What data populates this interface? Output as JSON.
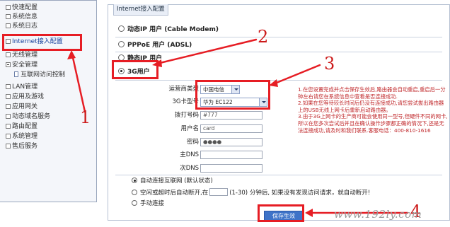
{
  "sidebar": {
    "items": [
      {
        "label": "快速配置"
      },
      {
        "label": "系统信息"
      },
      {
        "label": "系统日志"
      },
      {
        "label": "Internet接入配置"
      },
      {
        "label": "无线管理"
      },
      {
        "label": "安全管理"
      },
      {
        "label": "互联网访问控制"
      },
      {
        "label": "LAN管理"
      },
      {
        "label": "应用及游戏"
      },
      {
        "label": "应用网关"
      },
      {
        "label": "动态域名服务"
      },
      {
        "label": "路由配置"
      },
      {
        "label": "系统管理"
      },
      {
        "label": "售后服务"
      }
    ]
  },
  "panel": {
    "title": "Internet接入配置",
    "modes": [
      {
        "label": "动态IP 用户 (Cable Modem)"
      },
      {
        "label": "PPPoE 用户 (ADSL)"
      },
      {
        "label": "静态IP 用户"
      },
      {
        "label": "3G用户"
      }
    ]
  },
  "form": {
    "operator_label": "运营商类型",
    "operator_value": "中国电信",
    "model_label": "3G卡型号",
    "model_value": "华为 EC122",
    "dial_label": "拨打号码",
    "dial_value": "#777",
    "user_label": "用户名",
    "user_value": "card",
    "pass_label": "密码",
    "pass_value": "●●●●",
    "dns1_label": "主DNS",
    "dns2_label": "次DNS"
  },
  "notes": {
    "p1": "1.在您设置完成并点击保存生效后,路由器会自动重启,重启后一分钟左右请您在系统信息中查看是否连接成功.",
    "p2": "2.如果在您等待较长时间后仍没有连接成功,请您尝试拔出路由器上的USB无线上网卡后重新启动路由器。",
    "p3": "3.由于3G上网卡的生产商可能会使用同一型号,但硬件不同的网卡,所以在您多次尝试后并且在确认操作步骤都正确的情况下,还是无法连接成功,请及时和我们联系.客服电话：400-810-1616"
  },
  "options": {
    "auto": "自动连接互联网 (默认状态)",
    "idle_prefix": "空闲或超时后自动断开,在",
    "idle_suffix": "(1-30) 分钟后, 如果没有发现访问请求，就自动断开!",
    "manual": "手动连接"
  },
  "save_label": "保存生效",
  "annotations": {
    "n1": "1",
    "n2": "2",
    "n3": "3",
    "n4": "4"
  },
  "watermark": "www.192ly.com",
  "colors": {
    "annotation_red": "#e61d24",
    "button_blue": "#3e73c8",
    "note_red": "#c0282b"
  }
}
